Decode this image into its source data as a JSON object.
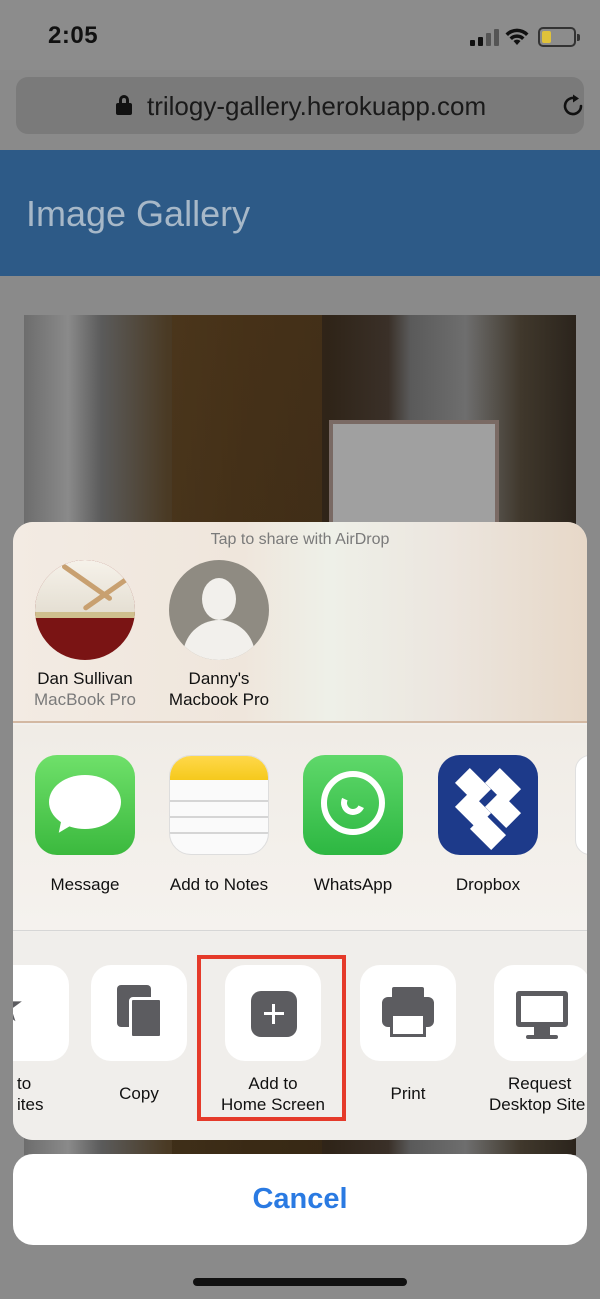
{
  "status_bar": {
    "time": "2:05",
    "battery_level": 0.25,
    "battery_color": "#e0c23a"
  },
  "url_bar": {
    "url": "trilogy-gallery.herokuapp.com",
    "lock_icon": "lock-icon",
    "reload_icon": "reload-icon"
  },
  "page": {
    "title": "Image Gallery",
    "header_color": "#2d5a87"
  },
  "share_sheet": {
    "airdrop_hint": "Tap to share with AirDrop",
    "airdrop_targets": [
      {
        "name": "Dan Sullivan",
        "device": "MacBook Pro"
      },
      {
        "name": "Danny's",
        "device": "Macbook Pro"
      }
    ],
    "apps": [
      {
        "label": "Message",
        "icon": "message-icon"
      },
      {
        "label": "Add to Notes",
        "icon": "notes-icon"
      },
      {
        "label": "WhatsApp",
        "icon": "whatsapp-icon"
      },
      {
        "label": "Dropbox",
        "icon": "dropbox-icon"
      }
    ],
    "actions": [
      {
        "label_line1": "to",
        "label_line2": "ites",
        "icon": "star-icon"
      },
      {
        "label": "Copy",
        "icon": "copy-icon"
      },
      {
        "label_line1": "Add to",
        "label_line2": "Home Screen",
        "icon": "plus-icon"
      },
      {
        "label": "Print",
        "icon": "print-icon"
      },
      {
        "label_line1": "Request",
        "label_line2": "Desktop Site",
        "icon": "desktop-icon"
      }
    ],
    "highlight_color": "#e53a2a",
    "cancel_label": "Cancel",
    "cancel_color": "#2a7ae2"
  }
}
